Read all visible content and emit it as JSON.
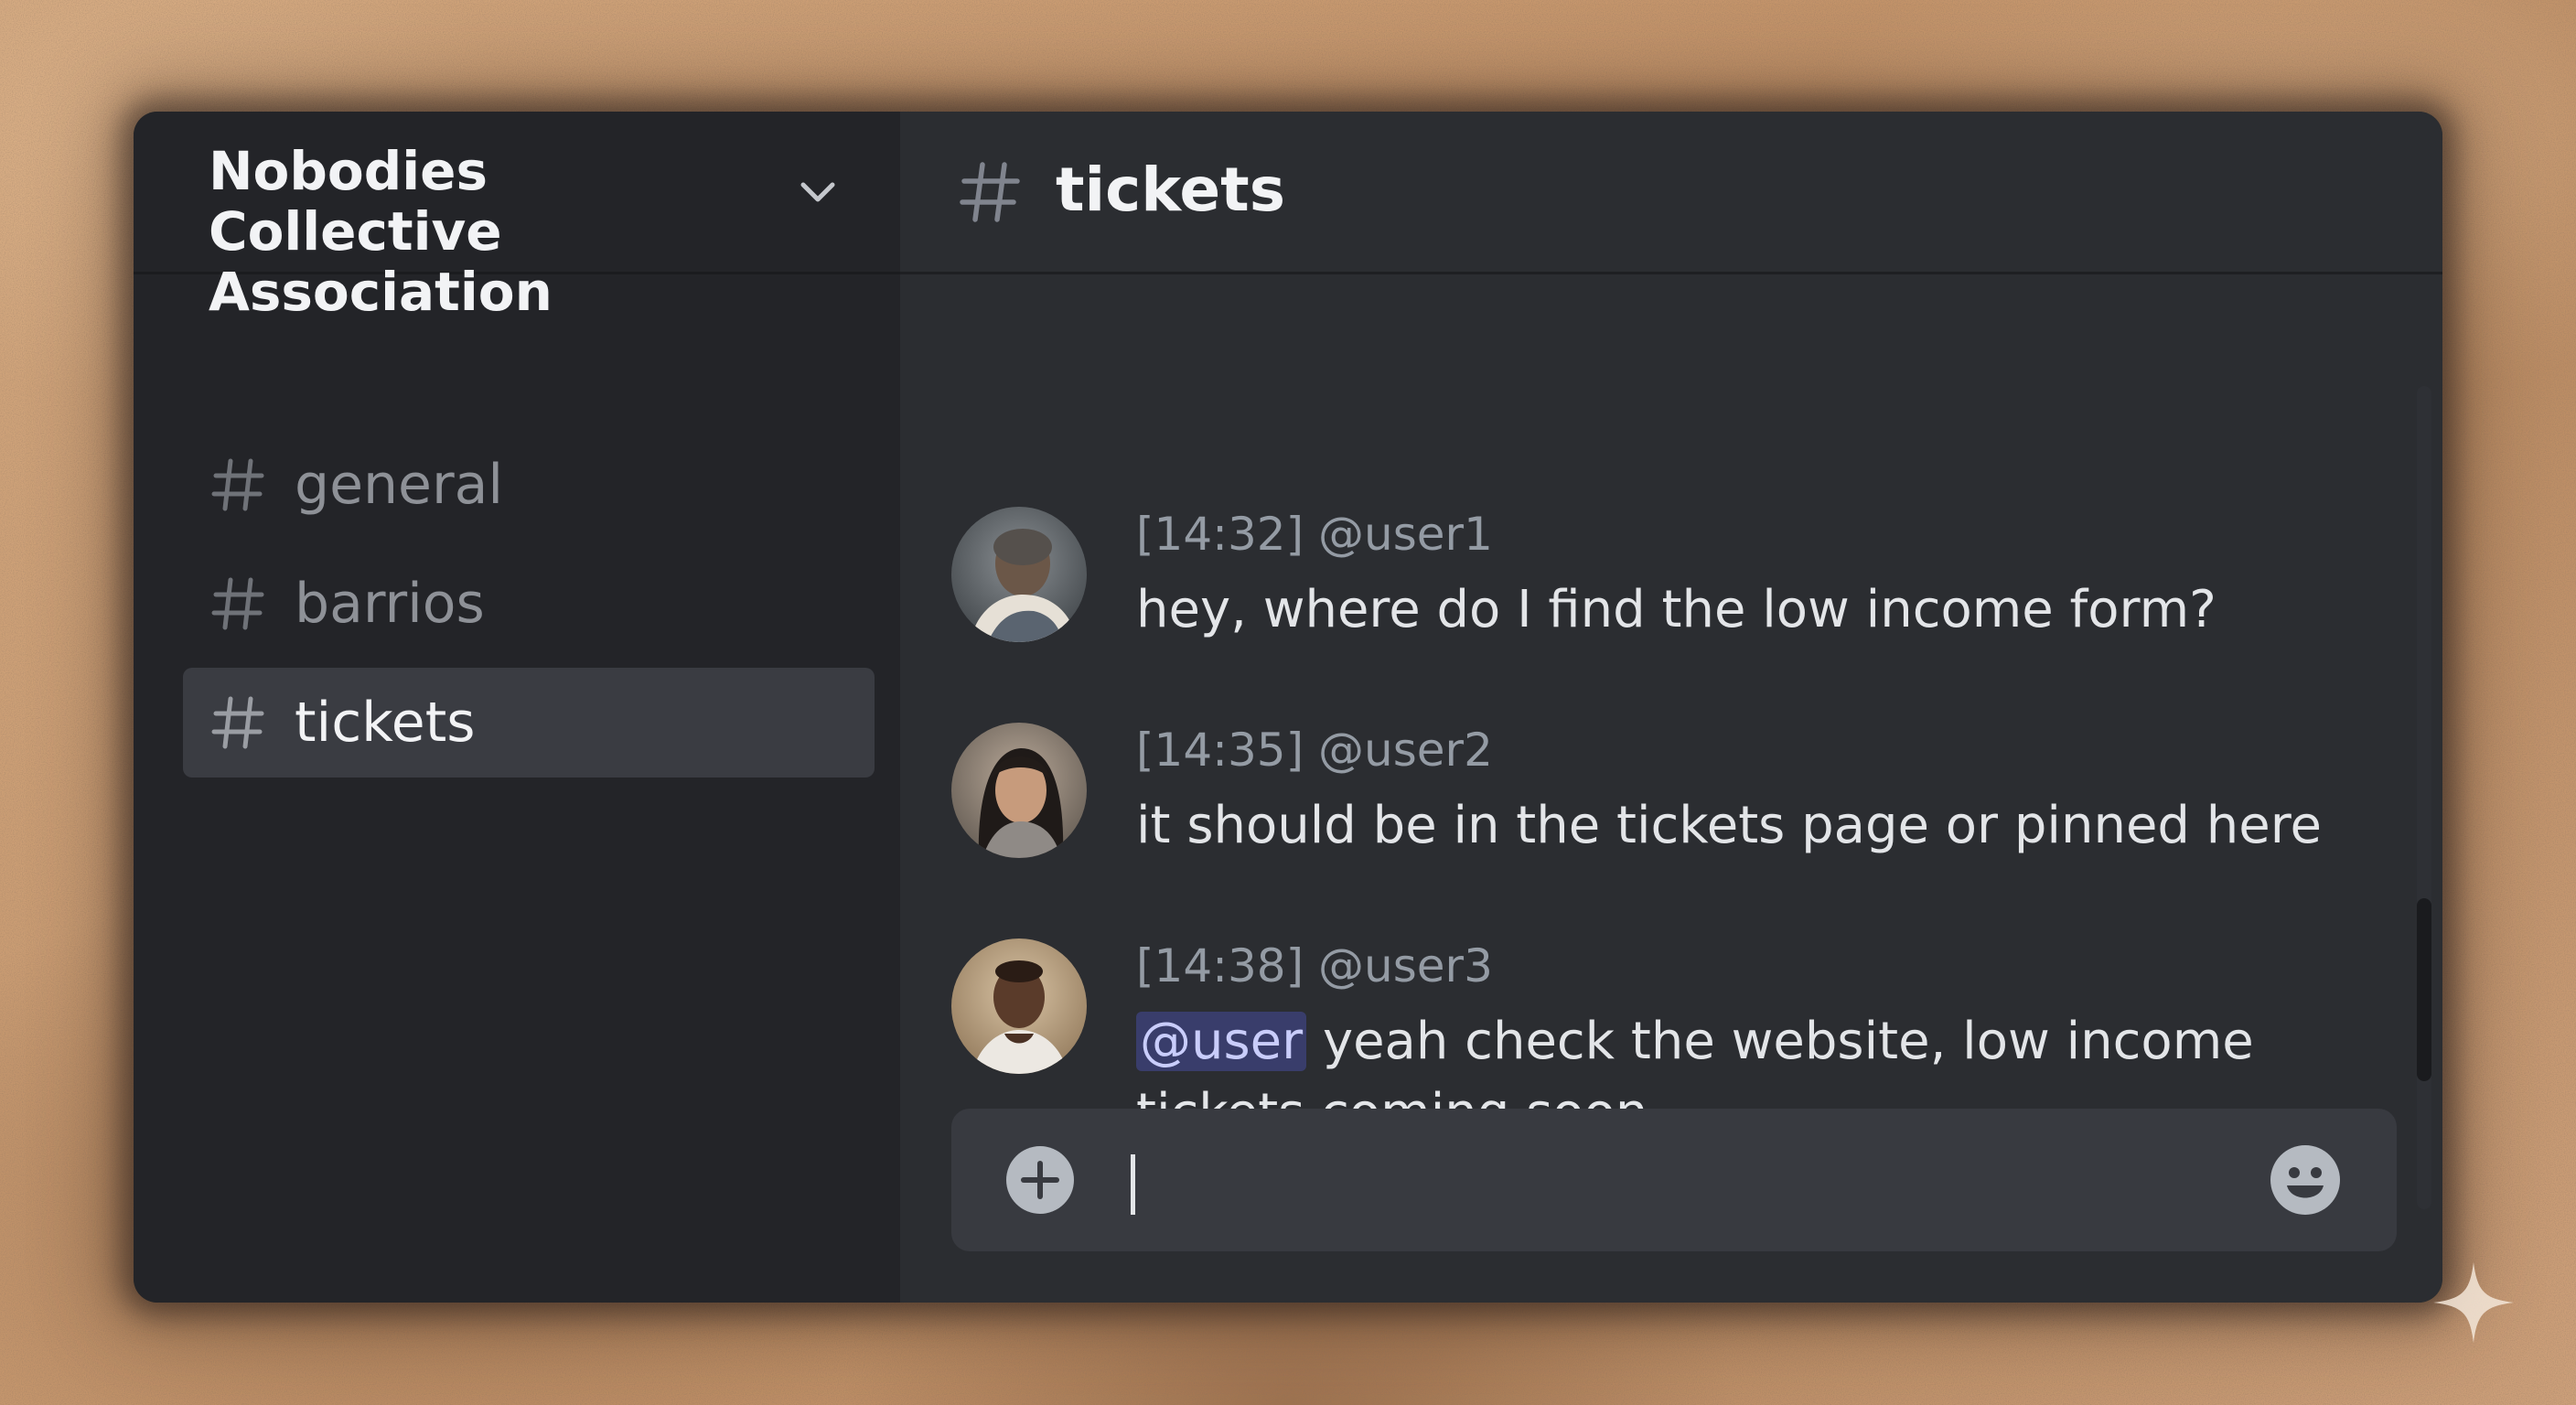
{
  "server": {
    "name": "Nobodies Collective Association",
    "icon": "chevron-down-icon"
  },
  "sidebar": {
    "channels": [
      {
        "name": "general",
        "icon": "hash-icon",
        "active": false
      },
      {
        "name": "barrios",
        "icon": "hash-icon",
        "active": false
      },
      {
        "name": "tickets",
        "icon": "hash-icon",
        "active": true
      }
    ]
  },
  "channel": {
    "name": "tickets",
    "icon": "hash-icon"
  },
  "messages": [
    {
      "time": "[14:32]",
      "author": "@user1",
      "text": "hey, where do I find the low income form?",
      "avatar": "avatar-user1"
    },
    {
      "time": "[14:35]",
      "author": "@user2",
      "text": "it should be in the tickets page or pinned here",
      "avatar": "avatar-user2"
    },
    {
      "time": "[14:38]",
      "author": "@user3",
      "mention": "@user",
      "text": " yeah check the website, low income tickets coming soon",
      "avatar": "avatar-user3"
    }
  ],
  "composer": {
    "value": "",
    "plus_icon": "plus-circle-icon",
    "emoji_icon": "smiley-icon"
  },
  "colors": {
    "window_bg": "#2b2d31",
    "sidebar_bg": "#232428",
    "active_channel_bg": "#3a3c42",
    "mention_bg": "#4b55a8",
    "text_primary": "#f2f3f5",
    "text_muted": "#8e9197",
    "backdrop": "#c69a72"
  }
}
